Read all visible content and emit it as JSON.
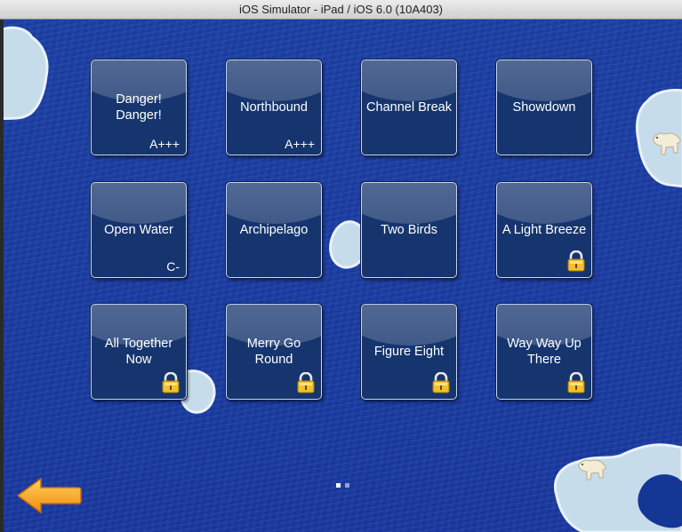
{
  "window": {
    "title": "iOS Simulator - iPad / iOS 6.0 (10A403)"
  },
  "levels": [
    {
      "name": "Danger!\nDanger!",
      "grade": "A+++",
      "locked": false
    },
    {
      "name": "Northbound",
      "grade": "A+++",
      "locked": false
    },
    {
      "name": "Channel Break",
      "grade": "",
      "locked": false
    },
    {
      "name": "Showdown",
      "grade": "",
      "locked": false
    },
    {
      "name": "Open Water",
      "grade": "C-",
      "locked": false
    },
    {
      "name": "Archipelago",
      "grade": "",
      "locked": false
    },
    {
      "name": "Two Birds",
      "grade": "",
      "locked": false
    },
    {
      "name": "A Light Breeze",
      "grade": "",
      "locked": true
    },
    {
      "name": "All Together\nNow",
      "grade": "",
      "locked": true
    },
    {
      "name": "Merry Go\nRound",
      "grade": "",
      "locked": true
    },
    {
      "name": "Figure Eight",
      "grade": "",
      "locked": true
    },
    {
      "name": "Way Way Up\nThere",
      "grade": "",
      "locked": true
    }
  ],
  "pagination": {
    "current_page": 1,
    "total_pages": 2
  },
  "colors": {
    "water": "#1a3fa6",
    "tile": "#16356e",
    "ice": "#c5dceb",
    "arrow": "#f7a51c",
    "lock": "#f2c12e"
  },
  "icons": {
    "back": "back-arrow-icon",
    "lock": "padlock-icon",
    "bear": "polar-bear-icon"
  }
}
